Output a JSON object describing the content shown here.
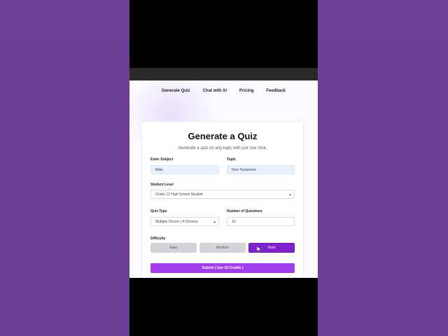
{
  "nav": {
    "items": [
      "Generate Quiz",
      "Chat with AI",
      "Pricing",
      "Feedback"
    ]
  },
  "card": {
    "title": "Generate a Quiz",
    "subtitle": "Generate a quiz on any topic with just one click."
  },
  "form": {
    "subject_label": "Enter Subject",
    "subject_value": "Bible",
    "topic_label": "Topic",
    "topic_value": "New Testament",
    "student_level_label": "Student Level",
    "student_level_value": "Grade 12 High School Student",
    "quiz_type_label": "Quiz Type",
    "quiz_type_value": "Multiple Choice | 4 Choices",
    "num_questions_label": "Number of Questions",
    "num_questions_value": "10",
    "difficulty_label": "Difficulty",
    "difficulty": [
      "Easy",
      "Medium",
      "Hard"
    ],
    "selected_difficulty": "Hard",
    "submit_label": "Submit ( Use 10 Credits )"
  },
  "colors": {
    "background_purple": "#6b3f93",
    "selected_button": "#7e23c9",
    "submit_button": "#a33fea",
    "input_blue": "#e8f0fd"
  },
  "icons": {
    "dropdown": "chevron-down-icon",
    "pointer": "mouse-pointer-icon"
  }
}
